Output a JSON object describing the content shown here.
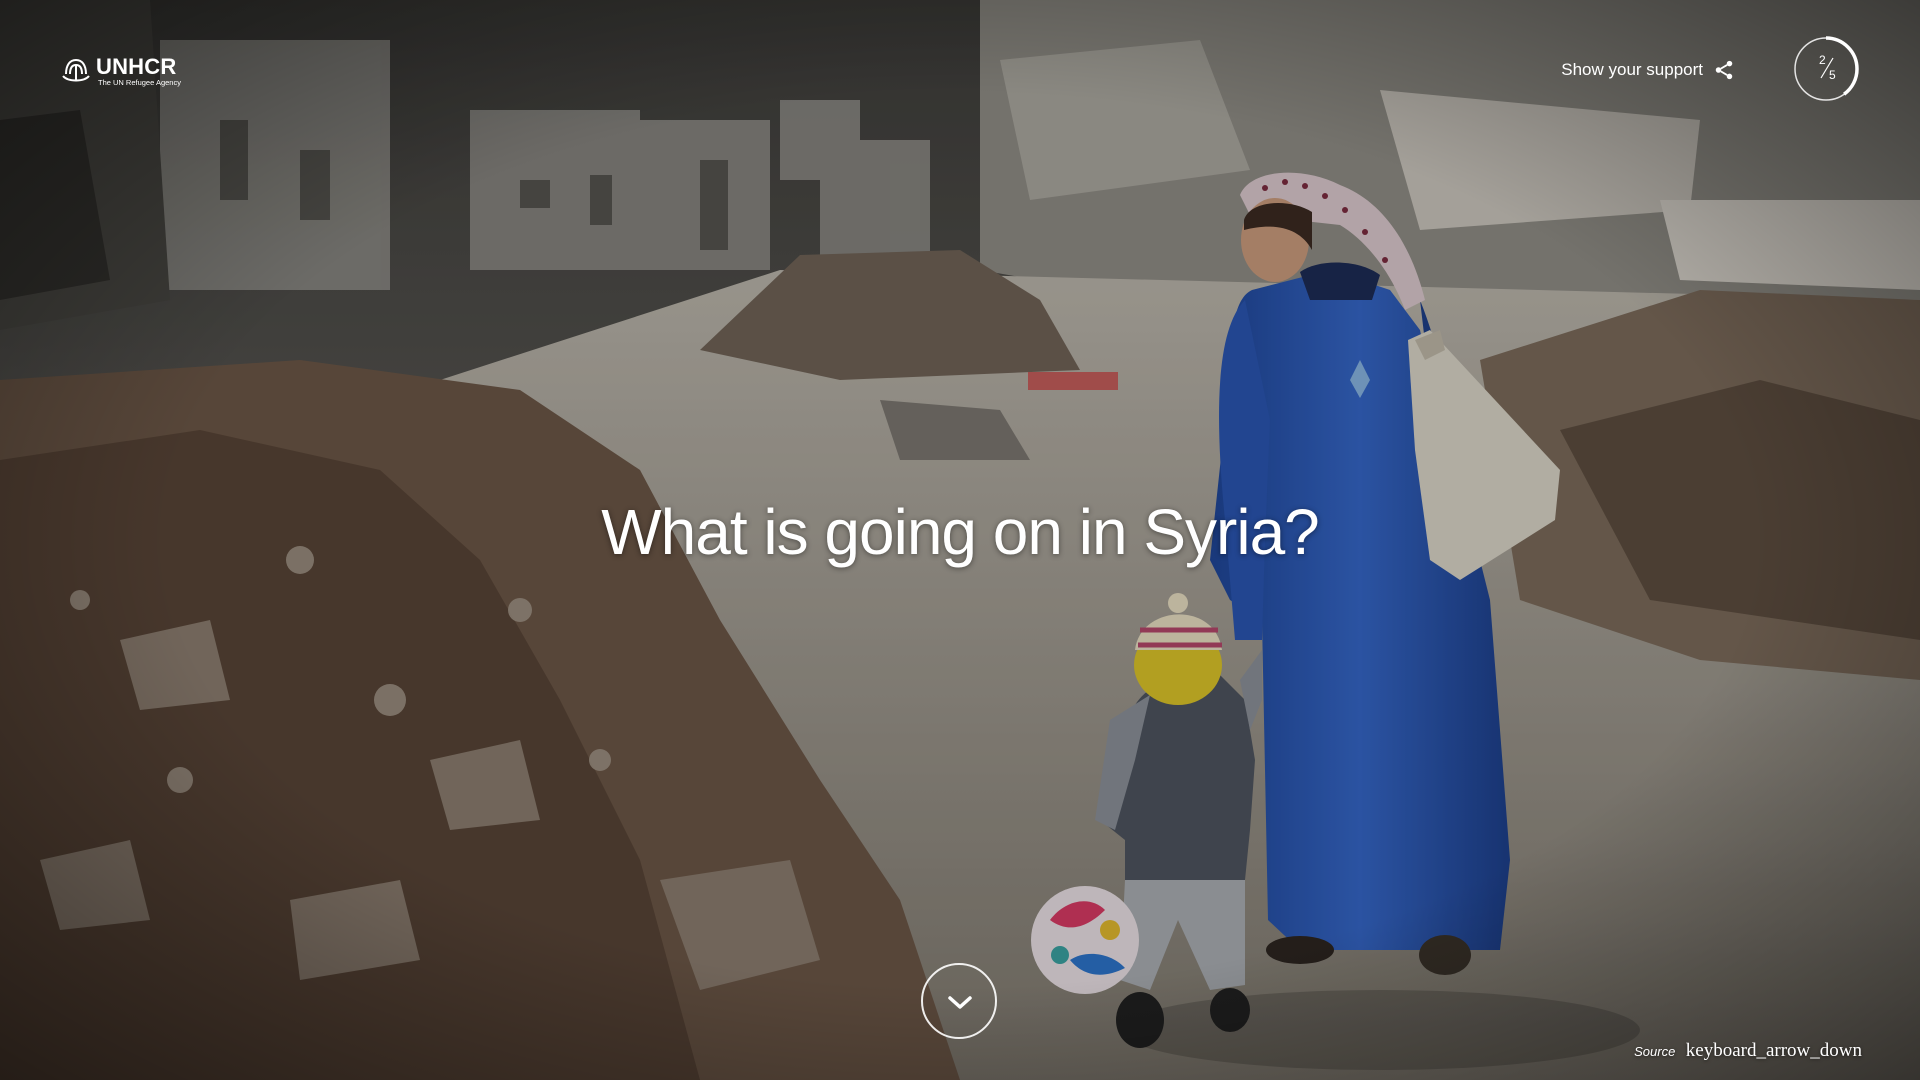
{
  "brand": {
    "name": "UNHCR",
    "tagline": "The UN Refugee Agency",
    "emblem_icon": "unhcr-emblem-icon"
  },
  "header": {
    "support_label": "Show your support",
    "share_icon": "share-icon"
  },
  "progress": {
    "current": "2",
    "total": "5",
    "fraction": 0.4
  },
  "hero": {
    "headline": "What is going on in Syria?",
    "scroll_icon": "chevron-down-icon"
  },
  "footer": {
    "source_label": "Source",
    "source_glyph_text": "keyboard_arrow_down"
  },
  "colors": {
    "text": "#ffffff",
    "sky": "#5f5e5a",
    "road": "#a09b90",
    "rubble": "#6e5c4d",
    "robe": "#2f5bb8"
  }
}
